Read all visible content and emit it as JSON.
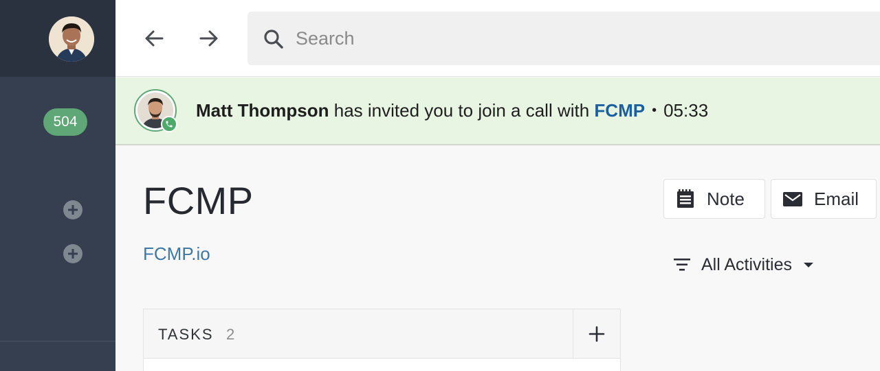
{
  "sidebar": {
    "badge_count": "504"
  },
  "topbar": {
    "search_placeholder": "Search"
  },
  "call_banner": {
    "caller_name": "Matt Thompson",
    "message": " has invited you to join a call with ",
    "organization": "FCMP",
    "separator": "•",
    "elapsed_time": "05:33",
    "status_color": "#5fa776"
  },
  "main": {
    "title": "FCMP",
    "website": "FCMP.io",
    "note_label": "Note",
    "email_label": "Email",
    "filter_label": "All Activities",
    "tasks": {
      "title": "TASKS",
      "count": "2"
    }
  }
}
